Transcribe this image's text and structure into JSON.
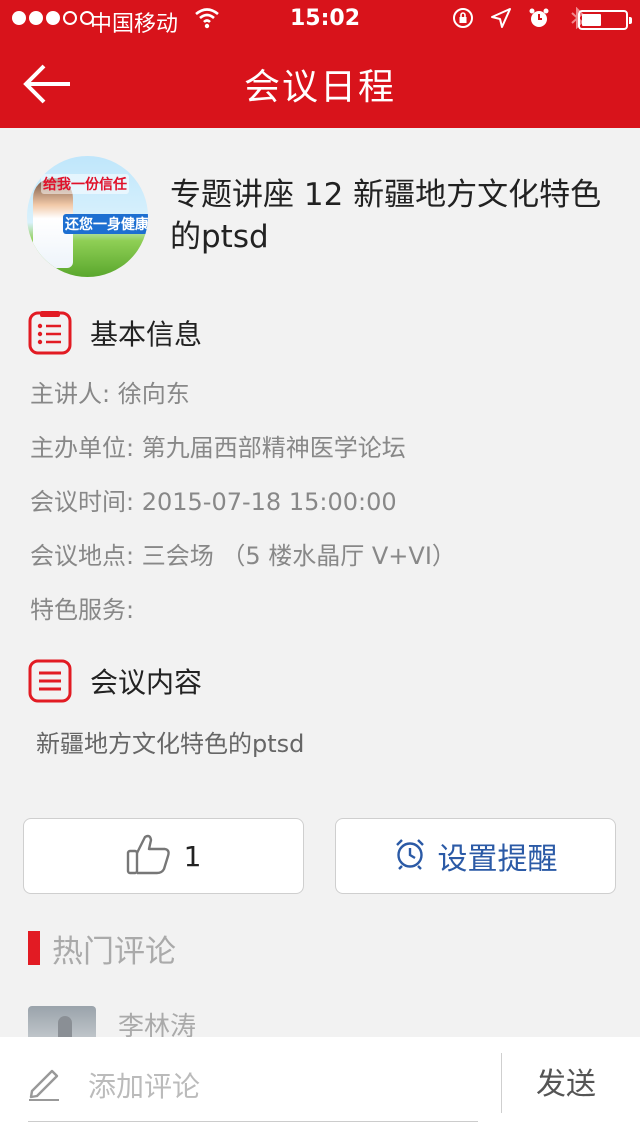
{
  "status_bar": {
    "carrier": "中国移动",
    "time": "15:02",
    "signal_bars_filled": 3,
    "signal_bars_total": 5,
    "battery_level": 0.45
  },
  "nav": {
    "title": "会议日程",
    "back_icon": "arrow-left-icon"
  },
  "session": {
    "title": "专题讲座 12 新疆地方文化特色的ptsd",
    "avatar_slogan_1": "给我一份信任",
    "avatar_slogan_2": "还您一身健康"
  },
  "basic_info": {
    "label": "基本信息",
    "icon": "list-icon",
    "lines": [
      "主讲人: 徐向东",
      "主办单位: 第九届西部精神医学论坛",
      "会议时间: 2015-07-18 15:00:00",
      "会议地点: 三会场 （5 楼水晶厅 V+VI）",
      "特色服务:"
    ]
  },
  "content": {
    "label": "会议内容",
    "icon": "document-icon",
    "text": "新疆地方文化特色的ptsd"
  },
  "actions": {
    "like_count": "1",
    "like_icon": "thumbs-up-icon",
    "remind_label": "设置提醒",
    "remind_icon": "alarm-clock-icon"
  },
  "hot_comments": {
    "title": "热门评论",
    "items": [
      {
        "name": "李林涛"
      }
    ]
  },
  "composer": {
    "placeholder": "添加评论",
    "send_label": "发送",
    "pencil_icon": "pencil-icon"
  },
  "colors": {
    "brand_red": "#d8131b",
    "remind_blue": "#2b5aa6"
  }
}
